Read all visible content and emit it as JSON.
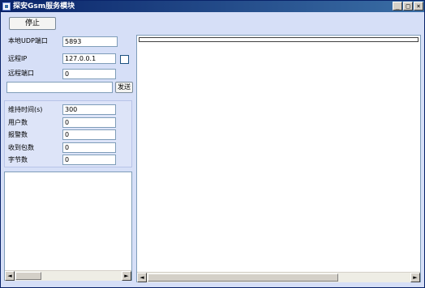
{
  "window": {
    "title": "探安Gsm服务模块",
    "minimize_label": "_",
    "maximize_label": "□",
    "close_label": "×"
  },
  "toolbar": {
    "stop_label": "停止"
  },
  "connection": {
    "local_udp_port_label": "本地UDP端口",
    "local_udp_port_value": "5893",
    "remote_ip_label": "远程IP",
    "remote_ip_value": "127.0.0.1",
    "remote_ip_checked": false,
    "remote_port_label": "远程端口",
    "remote_port_value": "0",
    "send_input_value": "",
    "send_label": "发送"
  },
  "stats": {
    "keep_time_label": "维持时间(s)",
    "keep_time_value": "300",
    "user_count_label": "用户数",
    "user_count_value": "0",
    "alarm_count_label": "报警数",
    "alarm_count_value": "0",
    "packets_received_label": "收到包数",
    "packets_received_value": "0",
    "byte_count_label": "字节数",
    "byte_count_value": "0"
  },
  "scrollbar": {
    "left_arrow": "◄",
    "right_arrow": "►"
  },
  "colors": {
    "window_bg": "#d6dff7",
    "titlebar": "#0a246a",
    "panel_border": "#7f9db9"
  }
}
